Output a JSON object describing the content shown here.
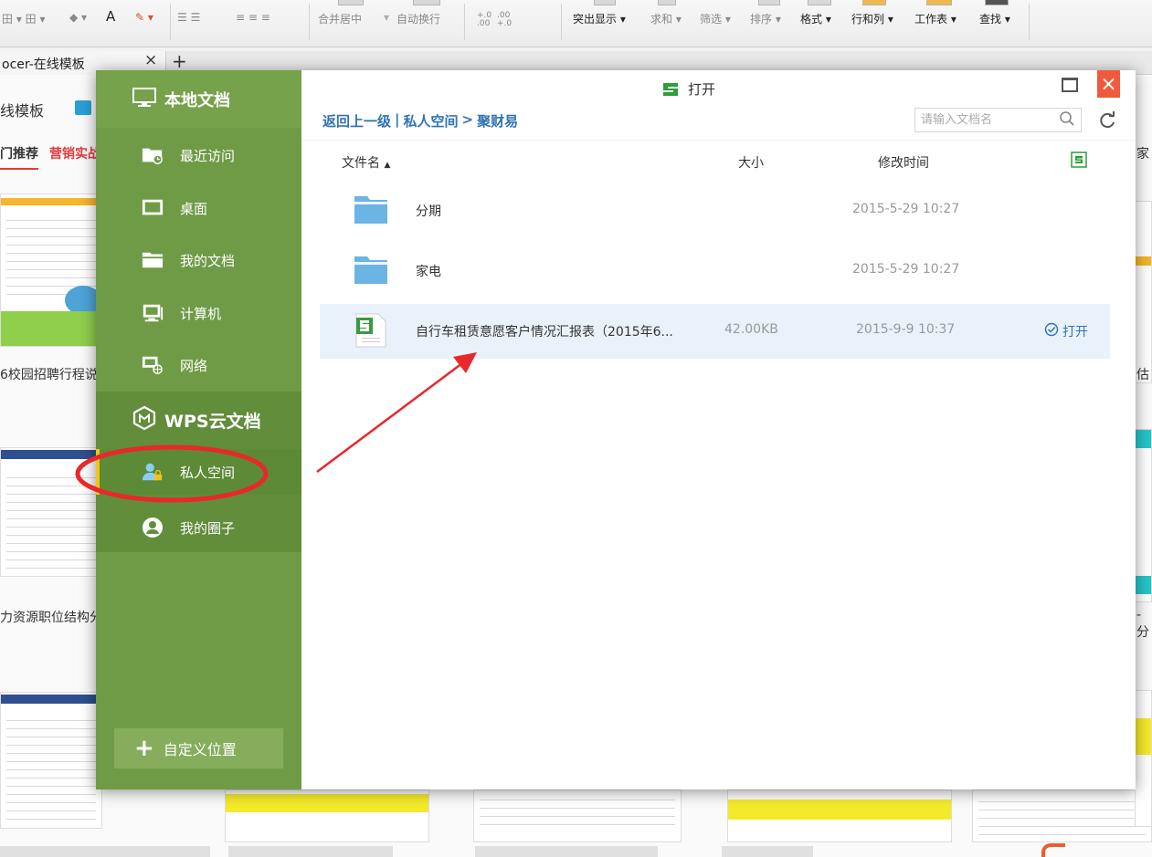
{
  "ribbon": {
    "merge_center": "合并居中",
    "auto_wrap": "自动换行",
    "dec_inc": "+.0",
    "dec_inc2": ".00",
    "dec_dec": ".00",
    "dec_dec2": "+.0",
    "highlight": "突出显示",
    "sum": "求和",
    "filter": "筛选",
    "sort": "排序",
    "format": "格式",
    "rows_cols": "行和列",
    "worksheet": "工作表",
    "find": "查找",
    "font_a": "A"
  },
  "tab": {
    "doc_title": "ocer-在线模板",
    "close_glyph": "×",
    "new_glyph": "+"
  },
  "background": {
    "heading": "线模板",
    "nav_recommend": "门推荐",
    "nav_marketing": "营销实战",
    "caption_1": "6校园招聘行程说",
    "caption_2": "力资源职位结构分",
    "right_1": "家",
    "right_2": "估",
    "right_3": "-分"
  },
  "dialog": {
    "title": "打开",
    "close_glyph": "×",
    "sidebar": {
      "local_header": "本地文档",
      "local_items": [
        {
          "label": "最近访问",
          "icon": "recent-folder-icon"
        },
        {
          "label": "桌面",
          "icon": "desktop-icon"
        },
        {
          "label": "我的文档",
          "icon": "documents-folder-icon"
        },
        {
          "label": "计算机",
          "icon": "computer-icon"
        },
        {
          "label": "网络",
          "icon": "network-icon"
        }
      ],
      "cloud_header": "WPS云文档",
      "cloud_items": [
        {
          "label": "私人空间",
          "icon": "private-space-icon",
          "active": true
        },
        {
          "label": "我的圈子",
          "icon": "circle-user-icon",
          "active": false
        }
      ],
      "custom_location": "自定义位置",
      "plus_glyph": "+"
    },
    "breadcrumb": {
      "back": "返回上一级",
      "sep": "|",
      "private_space": "私人空间",
      "arrow": ">",
      "current": "聚财易"
    },
    "search": {
      "placeholder": "请输入文档名"
    },
    "columns": {
      "name": "文件名",
      "sort_glyph": "▲",
      "size": "大小",
      "modified": "修改时间"
    },
    "files": [
      {
        "type": "folder",
        "name": "分期",
        "size": "",
        "modified": "2015-5-29 10:27"
      },
      {
        "type": "folder",
        "name": "家电",
        "size": "",
        "modified": "2015-5-29 10:27"
      },
      {
        "type": "spreadsheet",
        "name": "自行车租赁意愿客户情况汇报表（2015年6...",
        "size": "42.00KB",
        "modified": "2015-9-9 10:37",
        "action": "打开",
        "selected": true
      }
    ]
  },
  "colors": {
    "sidebar_green": "#6f9b47",
    "link_blue": "#2f73b5",
    "close_red": "#f05a3c",
    "annotation_red": "#e8282a",
    "folder_blue": "#6cb4e4",
    "wps_green": "#2e9d3a"
  }
}
